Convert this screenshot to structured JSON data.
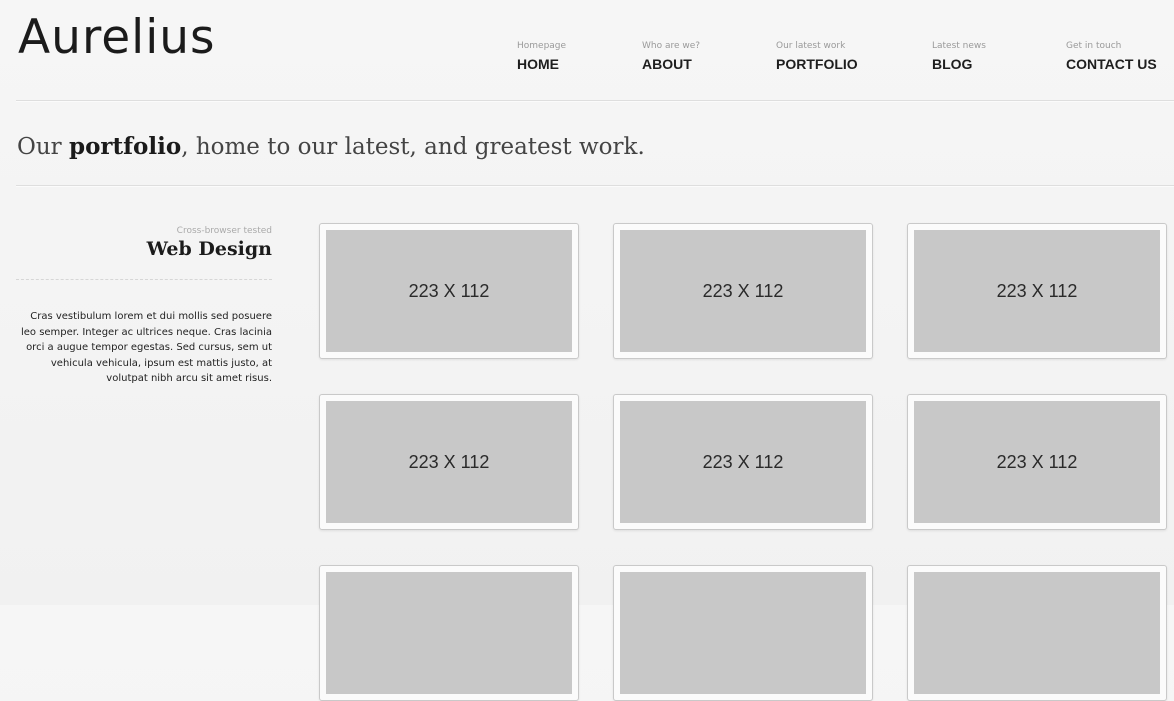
{
  "header": {
    "logo": "Aurelius",
    "nav": [
      {
        "sub": "Homepage",
        "label": "HOME"
      },
      {
        "sub": "Who are we?",
        "label": "ABOUT"
      },
      {
        "sub": "Our latest work",
        "label": "PORTFOLIO"
      },
      {
        "sub": "Latest news",
        "label": "BLOG"
      },
      {
        "sub": "Get in touch",
        "label": "CONTACT US"
      }
    ]
  },
  "intro": {
    "prefix": "Our ",
    "highlight": "portfolio",
    "suffix": ", home to our latest, and greatest work."
  },
  "sidebar": {
    "subtitle": "Cross-browser tested",
    "title": "Web Design",
    "text": "Cras vestibulum lorem et dui mollis sed posuere leo semper. Integer ac ultrices neque. Cras lacinia orci a augue tempor egestas. Sed cursus, sem ut vehicula vehicula, ipsum est mattis justo, at volutpat nibh arcu sit amet risus."
  },
  "portfolio": {
    "items": [
      {
        "label": "223 X 112"
      },
      {
        "label": "223 X 112"
      },
      {
        "label": "223 X 112"
      },
      {
        "label": "223 X 112"
      },
      {
        "label": "223 X 112"
      },
      {
        "label": "223 X 112"
      },
      {
        "label": ""
      },
      {
        "label": ""
      },
      {
        "label": ""
      }
    ]
  },
  "colors": {
    "background": "#f4f4f4",
    "placeholder": "#c8c8c8",
    "divider": "#dedede"
  }
}
